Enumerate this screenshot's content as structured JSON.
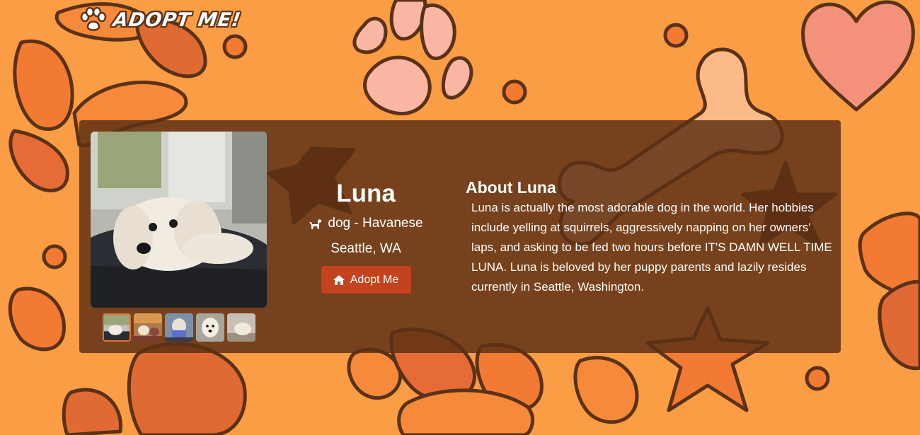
{
  "app": {
    "logo_text": "ADOPT ME!"
  },
  "pet": {
    "name": "Luna",
    "species_breed": "dog - Havanese",
    "location": "Seattle, WA",
    "adopt_button_label": "Adopt Me",
    "thumbnails_count": 5,
    "selected_thumbnail": 1
  },
  "about": {
    "title": "About Luna",
    "description": "Luna is actually the most adorable dog in the world. Her hobbies include yelling at squirrels, aggressively napping on her owners' laps, and asking to be fed two hours before IT'S DAMN WELL TIME LUNA. Luna is beloved by her puppy parents and lazily resides currently in Seattle, Washington."
  },
  "icons": {
    "logo": "paw-icon",
    "breed": "dog-icon",
    "adopt": "home-icon"
  },
  "colors": {
    "background": "#fb9d45",
    "card": "#5c3014",
    "button": "#c3431f",
    "outline": "#5b3217",
    "heart": "#f4917a",
    "paw_light": "#f8b6a3"
  }
}
